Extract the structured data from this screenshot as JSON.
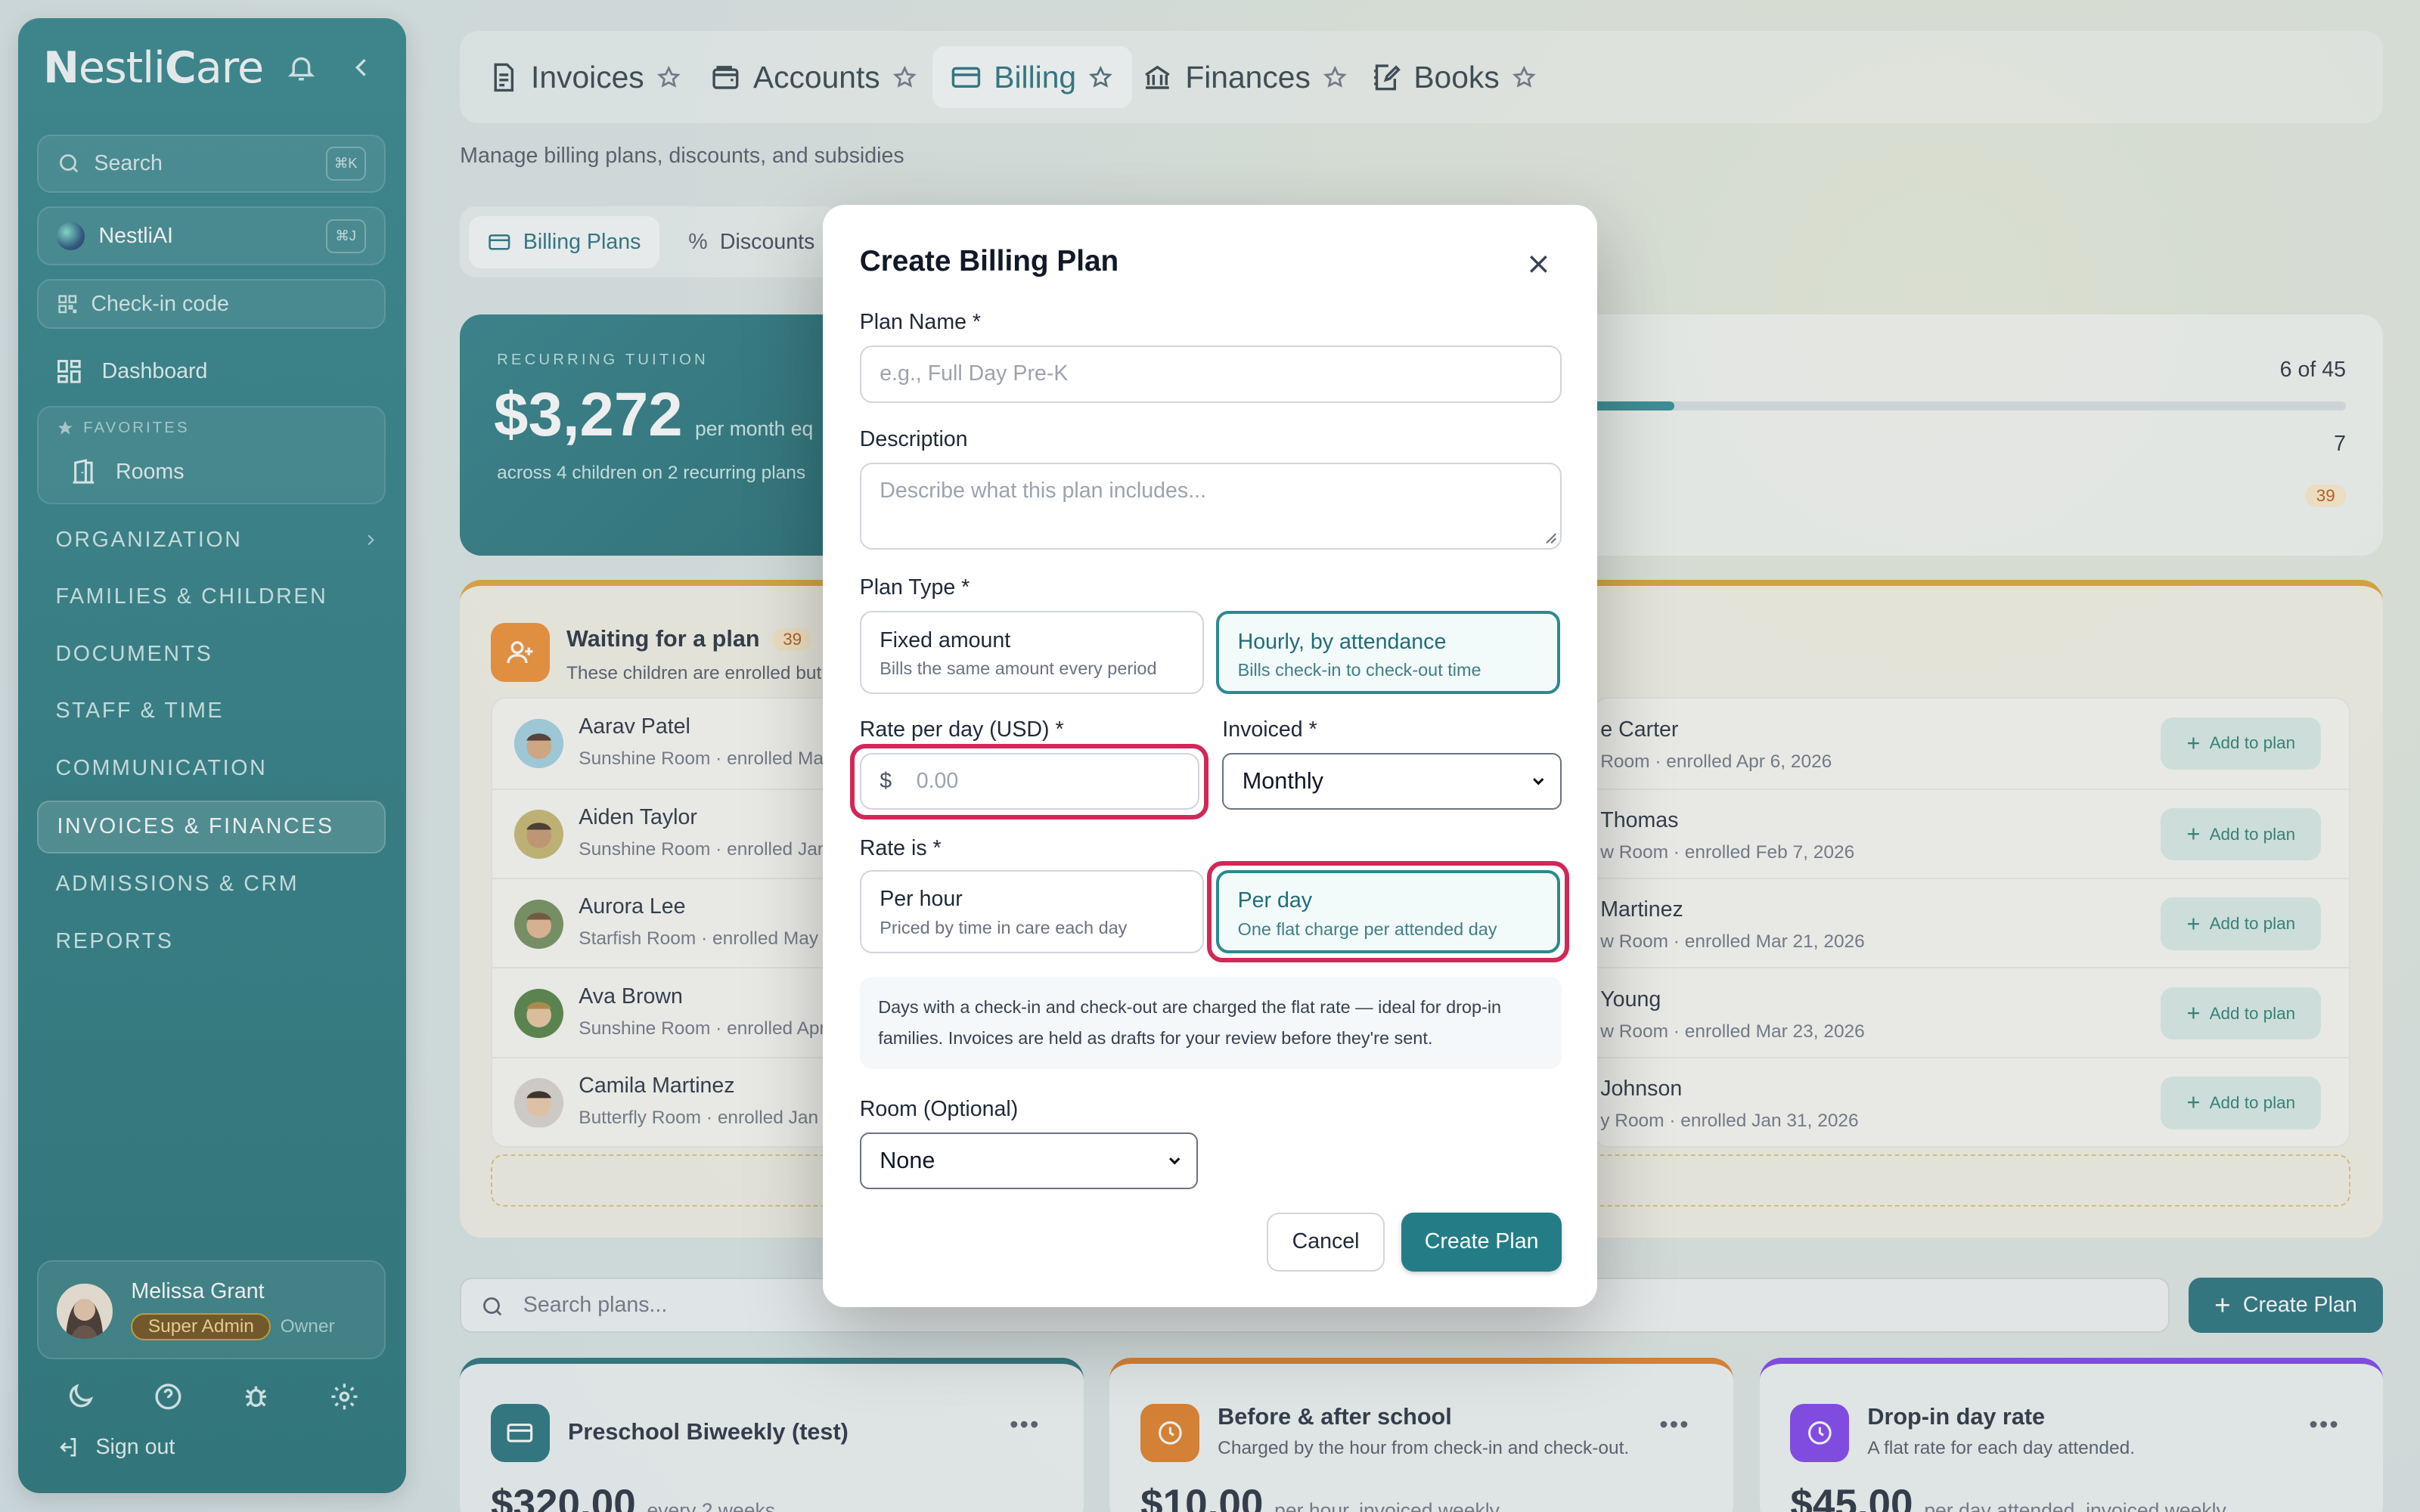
{
  "sidebar": {
    "logo_lead": "N",
    "logo_mid": "estli",
    "logo_bold": "C",
    "logo_end": "are",
    "search_placeholder": "Search",
    "search_kbd": "⌘K",
    "ai_label": "NestliAI",
    "ai_kbd": "⌘J",
    "checkin_label": "Check-in code",
    "dashboard_label": "Dashboard",
    "favorites_label": "FAVORITES",
    "rooms_label": "Rooms",
    "sections": [
      "ORGANIZATION",
      "FAMILIES & CHILDREN",
      "DOCUMENTS",
      "STAFF & TIME",
      "COMMUNICATION",
      "INVOICES & FINANCES",
      "ADMISSIONS & CRM",
      "REPORTS"
    ],
    "user_name": "Melissa Grant",
    "user_role": "Super Admin",
    "user_title": "Owner",
    "signout_label": "Sign out"
  },
  "tabs": [
    "Invoices",
    "Accounts",
    "Billing",
    "Finances",
    "Books"
  ],
  "subtitle": "Manage billing plans, discounts, and subsidies",
  "subtabs": [
    "Billing Plans",
    "Discounts"
  ],
  "tuition": {
    "label": "RECURRING TUITION",
    "amount": "$3,272",
    "per": "per month eq",
    "detail": "across 4 children on 2 recurring plans"
  },
  "stats": {
    "v1": "6 of 45",
    "v2": "7",
    "v3": "39"
  },
  "waiting": {
    "title": "Waiting for a plan",
    "count": "39",
    "desc": "These children are enrolled but",
    "left": [
      {
        "name": "Aarav Patel",
        "sub": "Sunshine Room · enrolled Mar"
      },
      {
        "name": "Aiden Taylor",
        "sub": "Sunshine Room · enrolled Jan"
      },
      {
        "name": "Aurora Lee",
        "sub": "Starfish Room · enrolled May 1"
      },
      {
        "name": "Ava Brown",
        "sub": "Sunshine Room · enrolled Apr"
      },
      {
        "name": "Camila Martinez",
        "sub": "Butterfly Room · enrolled Jan 2"
      }
    ],
    "right": [
      {
        "name": "e Carter",
        "sub": "Room · enrolled Apr 6, 2026"
      },
      {
        "name": "Thomas",
        "sub": "w Room · enrolled Feb 7, 2026"
      },
      {
        "name": "Martinez",
        "sub": "w Room · enrolled Mar 21, 2026"
      },
      {
        "name": "Young",
        "sub": "w Room · enrolled Mar 23, 2026"
      },
      {
        "name": "Johnson",
        "sub": "y Room · enrolled Jan 31, 2026"
      }
    ],
    "add_label": "Add to plan"
  },
  "search_plans_placeholder": "Search plans...",
  "create_plan_label": "Create Plan",
  "cards": [
    {
      "title": "Preschool Biweekly (test)",
      "sub": "",
      "price": "$320.00",
      "unit": "every 2 weeks",
      "color": "#1f6d77"
    },
    {
      "title": "Before & after school",
      "sub": "Charged by the hour from check-in and check-out.",
      "price": "$10.00",
      "unit": "per hour, invoiced weekly",
      "color": "#e07a1f"
    },
    {
      "title": "Drop-in day rate",
      "sub": "A flat rate for each day attended.",
      "price": "$45.00",
      "unit": "per day attended, invoiced weekly",
      "color": "#7c3aed"
    }
  ],
  "modal": {
    "title": "Create Billing Plan",
    "plan_name_label": "Plan Name *",
    "plan_name_placeholder": "e.g., Full Day Pre-K",
    "description_label": "Description",
    "description_placeholder": "Describe what this plan includes...",
    "plan_type_label": "Plan Type *",
    "plan_types": [
      {
        "title": "Fixed amount",
        "desc": "Bills the same amount every period"
      },
      {
        "title": "Hourly, by attendance",
        "desc": "Bills check-in to check-out time"
      }
    ],
    "rate_label": "Rate per day (USD) *",
    "currency": "$",
    "rate_placeholder": "0.00",
    "invoiced_label": "Invoiced *",
    "invoiced_value": "Monthly",
    "rate_is_label": "Rate is *",
    "rate_options": [
      {
        "title": "Per hour",
        "desc": "Priced by time in care each day"
      },
      {
        "title": "Per day",
        "desc": "One flat charge per attended day"
      }
    ],
    "note": "Days with a check-in and check-out are charged the flat rate — ideal for drop-in families. Invoices are held as drafts for your review before they're sent.",
    "room_label": "Room (Optional)",
    "room_value": "None",
    "cancel_label": "Cancel",
    "create_label": "Create Plan"
  }
}
